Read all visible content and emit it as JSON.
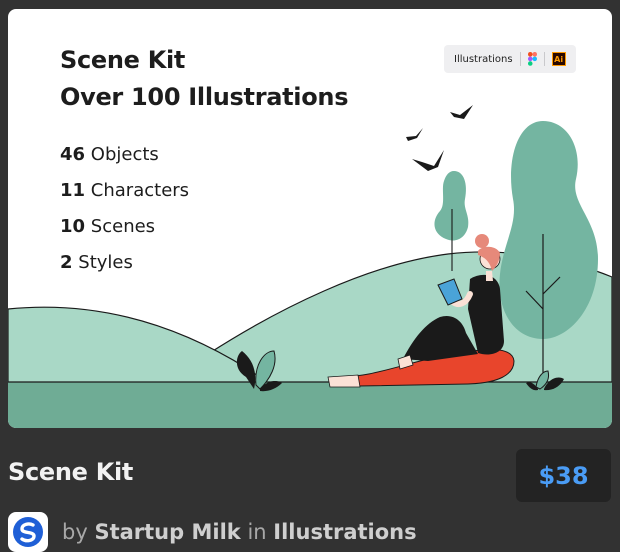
{
  "preview": {
    "title_line1": "Scene Kit",
    "title_line2": "Over 100 Illustrations",
    "stats": [
      {
        "count": "46",
        "label": "Objects"
      },
      {
        "count": "11",
        "label": "Characters"
      },
      {
        "count": "10",
        "label": "Scenes"
      },
      {
        "count": "2",
        "label": "Styles"
      }
    ],
    "badge_label": "Illustrations",
    "badge_ai_text": "Ai",
    "badge_icons": [
      "figma-icon",
      "illustrator-icon"
    ]
  },
  "product": {
    "title": "Scene Kit",
    "price": "$38"
  },
  "author": {
    "by": "by",
    "name": "Startup Milk",
    "in": "in",
    "category": "Illustrations"
  },
  "colors": {
    "page_bg": "#323232",
    "price_text": "#4a9cf5",
    "hill_light": "#a9d8c6",
    "ground": "#6fac95",
    "tree": "#74b5a1",
    "pants": "#e8452c",
    "book": "#4aa3d8"
  }
}
